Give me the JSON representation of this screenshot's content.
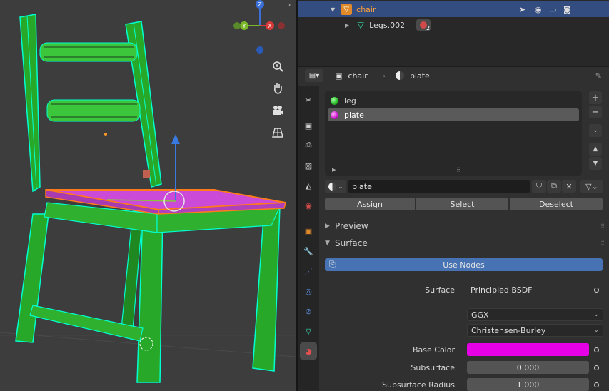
{
  "outliner": {
    "object_name": "chair",
    "child_name": "Legs.002",
    "child_badge": "2"
  },
  "props_header": {
    "object": "chair",
    "material": "plate"
  },
  "material_slots": [
    {
      "name": "leg",
      "color": "#2fbf2f"
    },
    {
      "name": "plate",
      "color": "#d21dd2"
    }
  ],
  "material_name": "plate",
  "buttons": {
    "assign": "Assign",
    "select": "Select",
    "deselect": "Deselect"
  },
  "panels": {
    "preview": "Preview",
    "surface": "Surface"
  },
  "use_nodes": "Use Nodes",
  "surface": {
    "surface_label": "Surface",
    "surface_value": "Principled BSDF",
    "distribution": "GGX",
    "subsurface_method": "Christensen-Burley",
    "base_color_label": "Base Color",
    "base_color": "#e600e6",
    "subsurface_label": "Subsurface",
    "subsurface_value": "0.000",
    "subsurface_radius_label": "Subsurface Radius",
    "subsurface_radius_value": "1.000"
  },
  "gizmo": {
    "x": "X",
    "y": "Y",
    "z": "Z"
  },
  "colors": {
    "accent": "#4772b3",
    "selected_row": "#334d80"
  }
}
